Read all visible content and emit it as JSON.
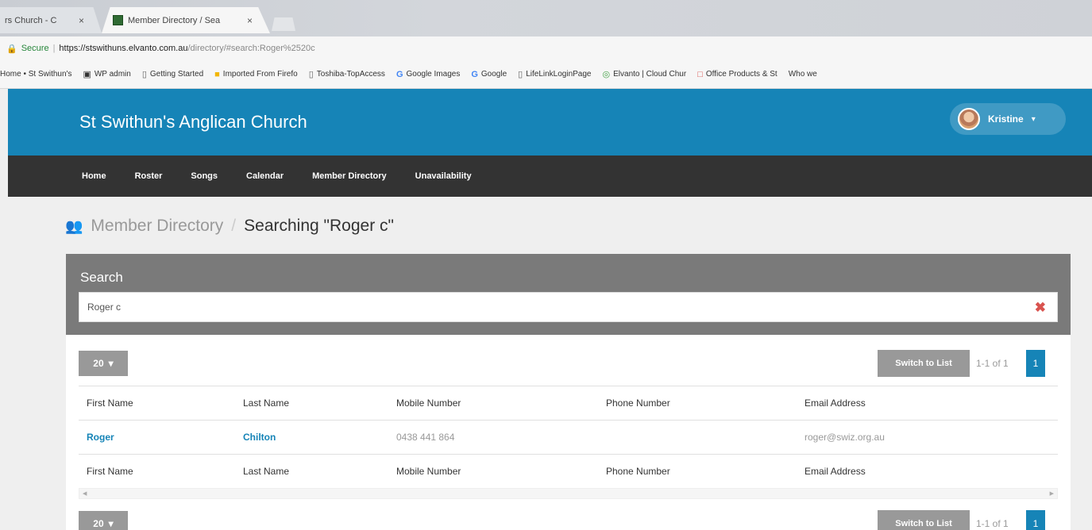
{
  "browser": {
    "tabs": [
      {
        "label": "rs Church - C",
        "close": "×"
      },
      {
        "label": "Member Directory / Sea",
        "close": "×"
      }
    ],
    "address": {
      "secure_label": "Secure",
      "separator": "|",
      "host": "https://stswithuns.elvanto.com.au",
      "path": "/directory/#search:Roger%2520c"
    },
    "bookmarks": [
      {
        "label": "Home • St Swithun's",
        "icon": "page-icon"
      },
      {
        "label": "WP admin",
        "icon": "wordpress-icon"
      },
      {
        "label": "Getting Started",
        "icon": "page-icon"
      },
      {
        "label": "Imported From Firefo",
        "icon": "folder-icon"
      },
      {
        "label": "Toshiba-TopAccess",
        "icon": "page-icon"
      },
      {
        "label": "Google Images",
        "icon": "google-icon"
      },
      {
        "label": "Google",
        "icon": "google-icon"
      },
      {
        "label": "LifeLinkLoginPage",
        "icon": "page-icon"
      },
      {
        "label": "Elvanto | Cloud Chur",
        "icon": "elvanto-icon"
      },
      {
        "label": "Office Products & St",
        "icon": "office-icon"
      },
      {
        "label": "Who we",
        "icon": ""
      }
    ]
  },
  "header": {
    "title": "St Swithun's Anglican Church",
    "user": {
      "name": "Kristine",
      "caret": "▾"
    }
  },
  "nav": {
    "items": [
      "Home",
      "Roster",
      "Songs",
      "Calendar",
      "Member Directory",
      "Unavailability"
    ]
  },
  "breadcrumb": {
    "parent": "Member Directory",
    "separator": "/",
    "current": "Searching \"Roger c\""
  },
  "search": {
    "label": "Search",
    "value": "Roger c",
    "clear": "✖"
  },
  "results": {
    "per_page": "20",
    "switch_label": "Switch to List",
    "range": "1-1 of 1",
    "page": "1",
    "columns": [
      "First Name",
      "Last Name",
      "Mobile Number",
      "Phone Number",
      "Email Address"
    ],
    "rows": [
      {
        "first": "Roger",
        "last": "Chilton",
        "mobile": "0438 441 864",
        "phone": "",
        "email": "roger@swiz.org.au"
      }
    ]
  },
  "colors": {
    "header_blue": "#1684b7",
    "nav_dark": "#333333",
    "search_panel": "#7a7a7a",
    "clear_red": "#d9534f"
  }
}
